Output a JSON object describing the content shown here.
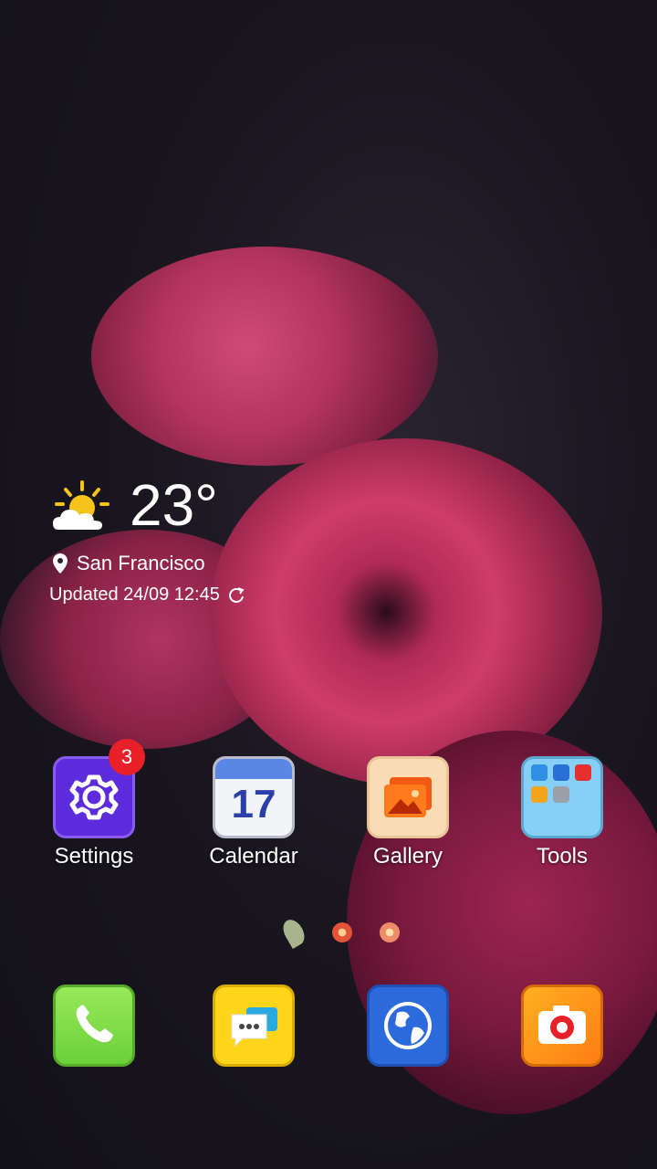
{
  "weather": {
    "temperature": "23°",
    "location": "San Francisco",
    "updated": "Updated 24/09 12:45",
    "icon": "partly-cloudy-sun-icon"
  },
  "apps": [
    {
      "name": "Settings",
      "icon": "gear-icon",
      "badge": "3"
    },
    {
      "name": "Calendar",
      "icon": "calendar-icon",
      "date": "17"
    },
    {
      "name": "Gallery",
      "icon": "image-icon"
    },
    {
      "name": "Tools",
      "icon": "folder-icon"
    }
  ],
  "dock": [
    {
      "icon": "phone-icon"
    },
    {
      "icon": "message-icon"
    },
    {
      "icon": "browser-globe-icon"
    },
    {
      "icon": "camera-icon"
    }
  ],
  "colors": {
    "badge": "#e8202a",
    "settings": "#5b2bdc",
    "calendar_header": "#5a86e6",
    "phone": "#6bd13a",
    "message": "#ffd51c",
    "browser": "#2d6bdc",
    "camera": "#ff7c14"
  }
}
